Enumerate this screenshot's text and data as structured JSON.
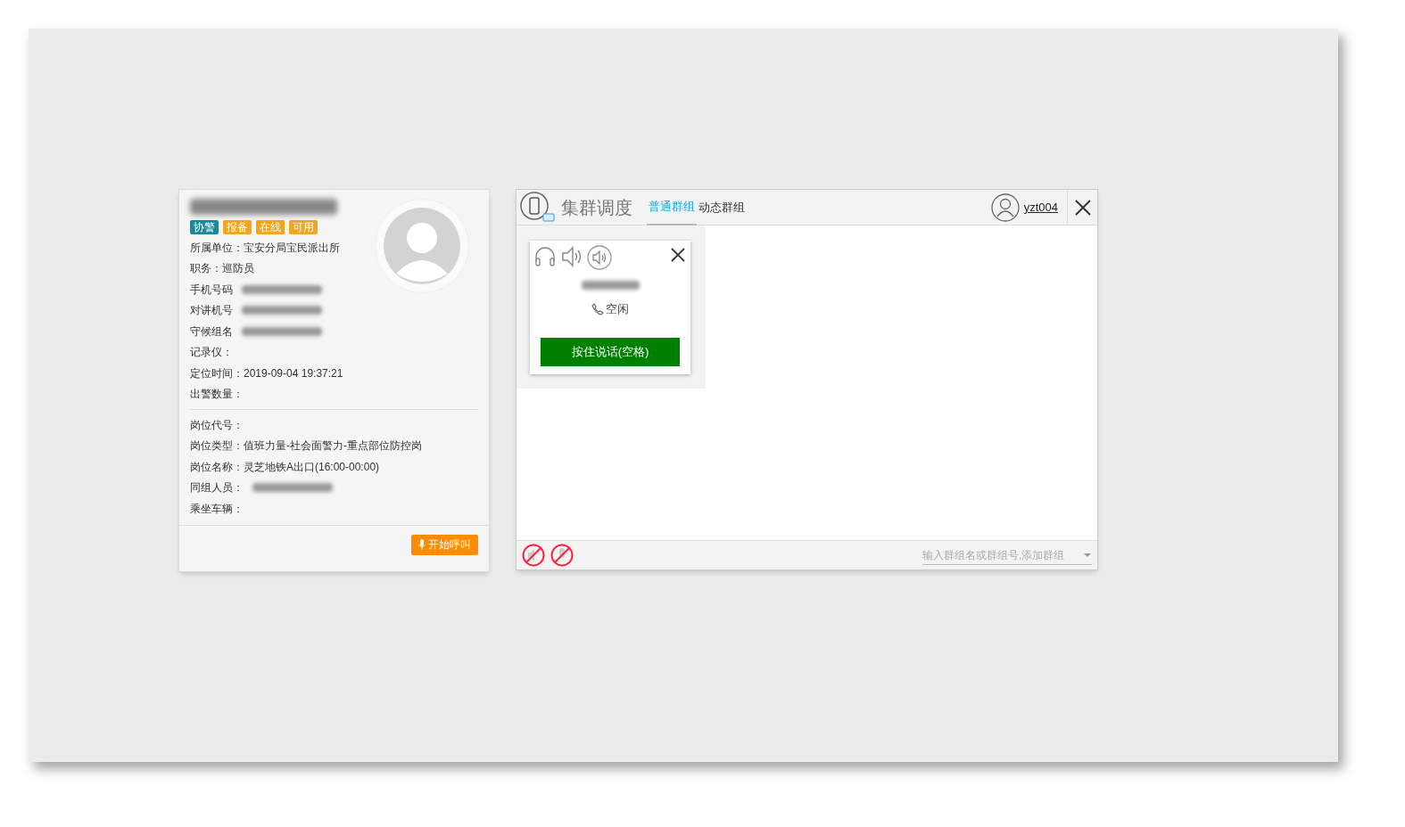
{
  "person_card": {
    "name_redacted": true,
    "tags": [
      {
        "label": "协警",
        "color": "#1a8a9a"
      },
      {
        "label": "报备",
        "color": "#f5a41d"
      },
      {
        "label": "在线",
        "color": "#f5a41d"
      },
      {
        "label": "可用",
        "color": "#f5a41d"
      }
    ],
    "fields": [
      {
        "kind": "text",
        "label": "所属单位：",
        "value": "宝安分局宝民派出所"
      },
      {
        "kind": "text",
        "label": "职务：",
        "value": "巡防员"
      },
      {
        "kind": "redacted",
        "label": "手机号码"
      },
      {
        "kind": "redacted",
        "label": "对讲机号"
      },
      {
        "kind": "redacted",
        "label": "守候组名"
      },
      {
        "kind": "text",
        "label": "记录仪："
      },
      {
        "kind": "text",
        "label": "定位时间：",
        "value": "2019-09-04 19:37:21"
      },
      {
        "kind": "text",
        "label": "出警数量："
      }
    ],
    "post_fields": [
      {
        "kind": "text",
        "label": "岗位代号："
      },
      {
        "kind": "text",
        "label": "岗位类型：",
        "value": "值班力量-社会面警力-重点部位防控岗"
      },
      {
        "kind": "text",
        "label": "岗位名称：",
        "value": "灵芝地铁A出口(16:00-00:00)"
      },
      {
        "kind": "redacted",
        "label": "同组人员："
      },
      {
        "kind": "text",
        "label": "乘坐车辆："
      }
    ],
    "call_button": "开始呼叫"
  },
  "dispatch": {
    "title": "集群调度",
    "tabs": [
      {
        "label": "普通群组",
        "selected": true
      },
      {
        "label": "动态群组",
        "selected": false
      }
    ],
    "user": "yzt004",
    "group_card": {
      "name_redacted": true,
      "status": "空闲",
      "talk_button": "按住说话(空格)"
    },
    "group_input": {
      "placeholder": "输入群组名或群组号,添加群组"
    }
  }
}
